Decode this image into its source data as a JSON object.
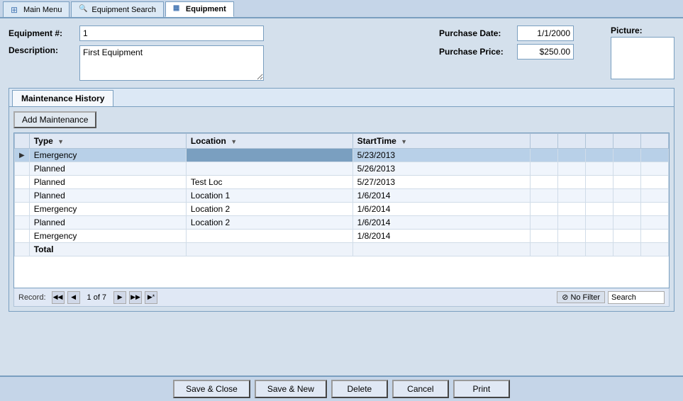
{
  "tabs": [
    {
      "id": "main-menu",
      "label": "Main Menu",
      "icon": "home",
      "active": false
    },
    {
      "id": "equipment-search",
      "label": "Equipment Search",
      "icon": "search",
      "active": false
    },
    {
      "id": "equipment",
      "label": "Equipment",
      "icon": "table",
      "active": true
    }
  ],
  "form": {
    "equipment_number_label": "Equipment #:",
    "equipment_number_value": "1",
    "description_label": "Description:",
    "description_value": "First Equipment",
    "purchase_date_label": "Purchase Date:",
    "purchase_date_value": "1/1/2000",
    "purchase_price_label": "Purchase Price:",
    "purchase_price_value": "$250.00",
    "picture_label": "Picture:"
  },
  "maintenance": {
    "tab_label": "Maintenance History",
    "add_button": "Add Maintenance",
    "columns": [
      {
        "id": "type",
        "label": "Type"
      },
      {
        "id": "location",
        "label": "Location"
      },
      {
        "id": "starttime",
        "label": "StartTime"
      }
    ],
    "rows": [
      {
        "indicator": "▶",
        "type": "Emergency",
        "location": "",
        "starttime": "5/23/2013",
        "selected": true
      },
      {
        "indicator": "",
        "type": "Planned",
        "location": "",
        "starttime": "5/26/2013",
        "selected": false
      },
      {
        "indicator": "",
        "type": "Planned",
        "location": "Test Loc",
        "starttime": "5/27/2013",
        "selected": false
      },
      {
        "indicator": "",
        "type": "Planned",
        "location": "Location 1",
        "starttime": "1/6/2014",
        "selected": false
      },
      {
        "indicator": "",
        "type": "Emergency",
        "location": "Location 2",
        "starttime": "1/6/2014",
        "selected": false
      },
      {
        "indicator": "",
        "type": "Planned",
        "location": "Location 2",
        "starttime": "1/6/2014",
        "selected": false
      },
      {
        "indicator": "",
        "type": "Emergency",
        "location": "",
        "starttime": "1/8/2014",
        "selected": false
      }
    ],
    "total_label": "Total"
  },
  "navigator": {
    "record_label": "Record:",
    "first_icon": "◀◀",
    "prev_icon": "◀",
    "next_icon": "▶",
    "last_icon": "▶▶",
    "new_icon": "▶*",
    "current": "1 of 7",
    "no_filter": "No Filter",
    "funnel_icon": "⊘",
    "search_placeholder": "Search"
  },
  "buttons": {
    "save_close": "Save & Close",
    "save_new": "Save & New",
    "delete": "Delete",
    "cancel": "Cancel",
    "print": "Print"
  }
}
